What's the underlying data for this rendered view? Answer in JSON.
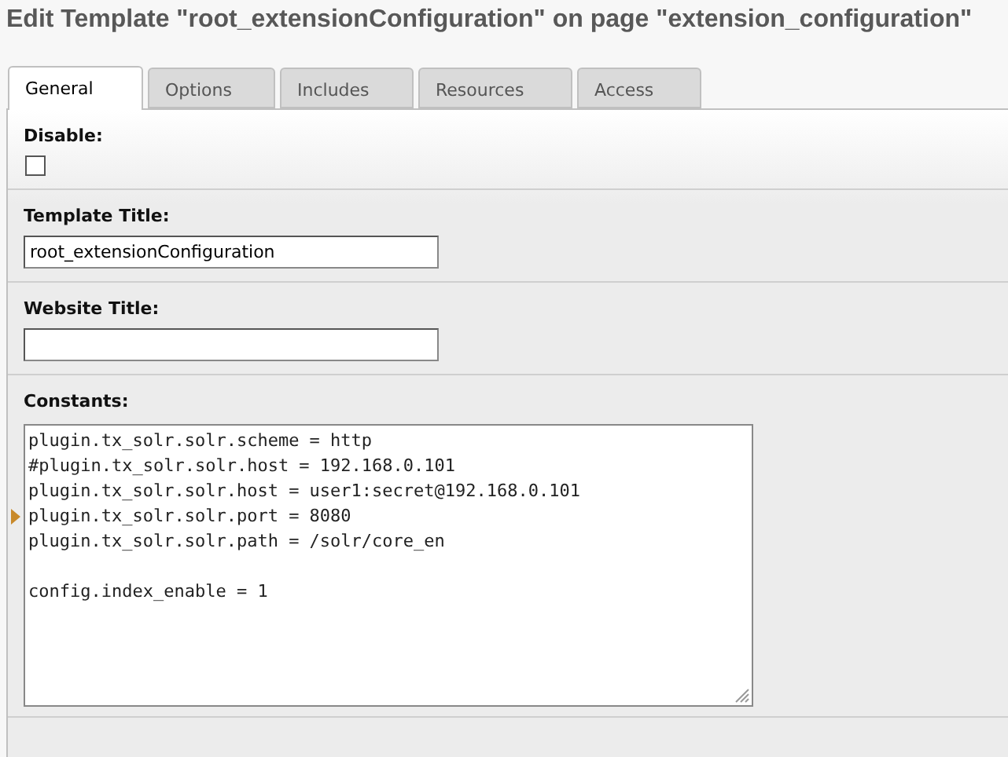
{
  "page_title": "Edit Template \"root_extensionConfiguration\" on page \"extension_configuration\"",
  "tabs": [
    {
      "label": "General",
      "selected": true
    },
    {
      "label": "Options",
      "selected": false
    },
    {
      "label": "Includes",
      "selected": false
    },
    {
      "label": "Resources",
      "selected": false
    },
    {
      "label": "Access",
      "selected": false
    }
  ],
  "fields": [
    {
      "kind": "checkbox",
      "label": "Disable:",
      "checked": false
    },
    {
      "kind": "text",
      "label": "Template Title:",
      "value": "root_extensionConfiguration"
    },
    {
      "kind": "text",
      "label": "Website Title:"
    },
    {
      "kind": "code",
      "label": "Constants:",
      "lines": [
        {
          "text": "plugin.tx_solr.solr.scheme = http",
          "marked": false
        },
        {
          "text": "#plugin.tx_solr.solr.host = 192.168.0.101",
          "marked": false
        },
        {
          "text": "plugin.tx_solr.solr.host = user1:secret@192.168.0.101",
          "marked": false
        },
        {
          "text": "plugin.tx_solr.solr.port = 8080",
          "marked": true
        },
        {
          "text": "plugin.tx_solr.solr.path = /solr/core_en",
          "marked": false
        },
        {
          "marked": false
        },
        {
          "text": "config.index_enable = 1",
          "marked": false
        }
      ]
    }
  ]
}
